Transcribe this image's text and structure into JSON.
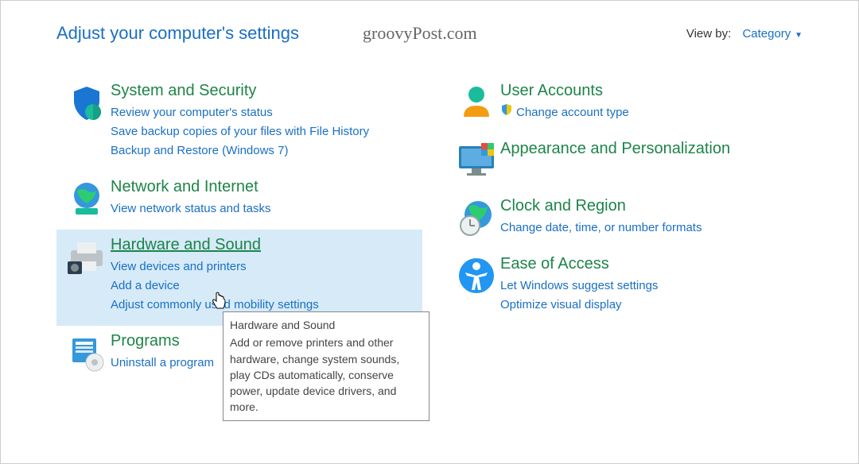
{
  "header": {
    "title": "Adjust your computer's settings",
    "watermark": "groovyPost.com",
    "viewby_label": "View by:",
    "viewby_value": "Category"
  },
  "left": [
    {
      "icon": "shield-icon",
      "title": "System and Security",
      "links": [
        "Review your computer's status",
        "Save backup copies of your files with File History",
        "Backup and Restore (Windows 7)"
      ]
    },
    {
      "icon": "globe-icon",
      "title": "Network and Internet",
      "links": [
        "View network status and tasks"
      ]
    },
    {
      "icon": "printer-icon",
      "title": "Hardware and Sound",
      "highlight": true,
      "links": [
        "View devices and printers",
        "Add a device",
        "Adjust commonly used mobility settings"
      ]
    },
    {
      "icon": "programs-icon",
      "title": "Programs",
      "links": [
        "Uninstall a program"
      ]
    }
  ],
  "right": [
    {
      "icon": "user-icon",
      "title": "User Accounts",
      "links": [
        {
          "shield": true,
          "text": "Change account type"
        }
      ]
    },
    {
      "icon": "display-icon",
      "title": "Appearance and Personalization",
      "links": []
    },
    {
      "icon": "clock-icon",
      "title": "Clock and Region",
      "links": [
        "Change date, time, or number formats"
      ]
    },
    {
      "icon": "accessibility-icon",
      "title": "Ease of Access",
      "links": [
        "Let Windows suggest settings",
        "Optimize visual display"
      ]
    }
  ],
  "tooltip": {
    "title": "Hardware and Sound",
    "body": "Add or remove printers and other hardware, change system sounds, play CDs automatically, conserve power, update device drivers, and more."
  }
}
